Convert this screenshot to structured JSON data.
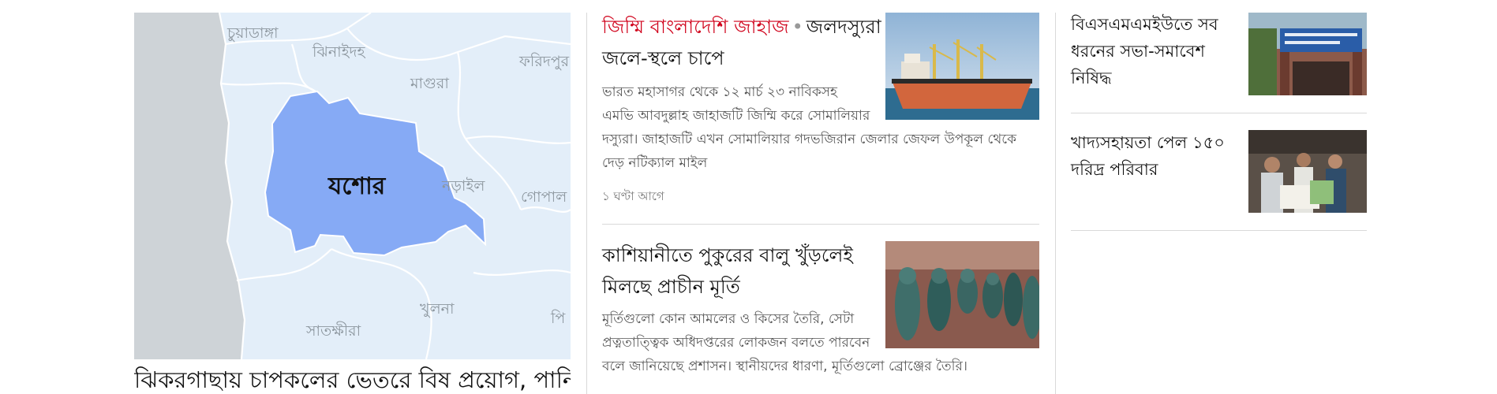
{
  "lead": {
    "map_labels": {
      "main": "যশোর",
      "chuadanga": "চুয়াডাঙ্গা",
      "jhenaidah": "ঝিনাইদহ",
      "faridpur": "ফরিদপুর",
      "magura": "মাগুরা",
      "narail": "নড়াইল",
      "gopalganj": "গোপাল",
      "khulna": "খুলনা",
      "satkhira": "সাতক্ষীরা",
      "pirojpur": "পি"
    },
    "title": "ঝিকরগাছায় চাপকলের ভেতরে বিষ প্রয়োগ, পানি"
  },
  "stories": [
    {
      "kicker": "জিম্মি বাংলাদেশি জাহাজ",
      "separator": "•",
      "title_line1": "জলদস্যুরা",
      "title_line2": "জলে-স্থলে চাপে",
      "summary_line1": "ভারত মহাসাগর থেকে ১২ মার্চ ২৩ নাবিকসহ",
      "summary_line2": "এমভি আবদুল্লাহ জাহাজটি জিম্মি করে সোমালিয়ার",
      "summary_line3": "দস্যুরা। জাহাজটি এখন সোমালিয়ার গদভজিরান জেলার জেফল উপকূল থেকে",
      "summary_line4": "দেড় নটিক্যাল মাইল",
      "time": "১ ঘণ্টা আগে",
      "image_icon": "cargo-ship-photo"
    },
    {
      "title_line1": "কাশিয়ানীতে পুকুরের বালু খুঁড়লেই",
      "title_line2": "মিলছে প্রাচীন মূর্তি",
      "summary_line1": "মূর্তিগুলো কোন আমলের ও কিসের তৈরি, সেটা",
      "summary_line2": "প্রত্নতাত্ত্বিক অধিদপ্তরের লোকজন বলতে পারবেন",
      "summary_line3": "বলে জানিয়েছে প্রশাসন। স্থানীয়দের ধারণা, মূর্তিগুলো ব্রোঞ্জের তৈরি।",
      "image_icon": "ancient-statues-photo"
    }
  ],
  "side": [
    {
      "title_line1": "বিএসএমএমইউতে সব",
      "title_line2": "ধরনের সভা-সমাবেশ",
      "title_line3": "নিষিদ্ধ",
      "image_icon": "university-gate-photo"
    },
    {
      "title_line1": "খাদ্যসহায়তা পেল ১৫০",
      "title_line2": "দরিদ্র পরিবার",
      "image_icon": "food-aid-photo"
    }
  ],
  "colors": {
    "kicker": "#d0021b",
    "map_highlight": "#86aaf5",
    "map_land": "#e3eef9",
    "map_sea": "#ced3d7"
  }
}
